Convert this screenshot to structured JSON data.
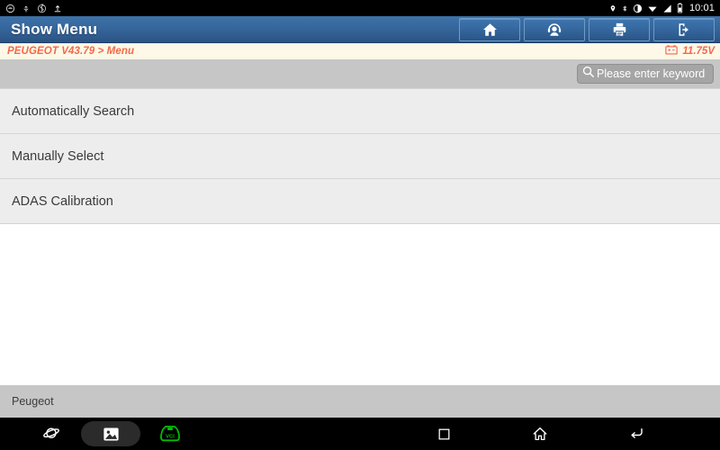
{
  "statusbar": {
    "left_icons": [
      "message-icon",
      "usb-icon",
      "bluetooth-settings-icon",
      "upload-icon"
    ],
    "right_icons": [
      "location-icon",
      "bluetooth-icon",
      "screen-rotate-icon",
      "wifi-icon",
      "cellular-signal-icon",
      "battery-icon"
    ],
    "clock": "10:01"
  },
  "header": {
    "title": "Show Menu",
    "buttons": [
      {
        "name": "home-button",
        "icon": "home-icon"
      },
      {
        "name": "support-button",
        "icon": "headset-person-icon"
      },
      {
        "name": "print-button",
        "icon": "printer-icon"
      },
      {
        "name": "exit-button",
        "icon": "exit-door-icon"
      }
    ]
  },
  "breadcrumb": {
    "path": "PEUGEOT V43.79 > Menu",
    "voltage": "11.75V",
    "voltage_icon": "car-battery-icon",
    "accent_color": "#f4694b"
  },
  "search": {
    "icon": "search-icon",
    "placeholder": "Please enter keyword",
    "value": ""
  },
  "menu": {
    "items": [
      {
        "label": "Automatically Search"
      },
      {
        "label": "Manually Select"
      },
      {
        "label": "ADAS Calibration"
      }
    ]
  },
  "footer": {
    "vehicle": "Peugeot"
  },
  "navbar": {
    "left_buttons": [
      {
        "name": "browser-button",
        "icon": "planet-icon"
      },
      {
        "name": "screenshot-button",
        "icon": "image-icon"
      },
      {
        "name": "vci-status-button",
        "icon": "vci-connector-icon",
        "label": "VCI",
        "color": "#00c000"
      }
    ],
    "system_buttons": [
      {
        "name": "recents-button",
        "icon": "square-icon"
      },
      {
        "name": "home-button",
        "icon": "home-outline-icon"
      },
      {
        "name": "back-button",
        "icon": "back-arrow-icon"
      }
    ]
  }
}
